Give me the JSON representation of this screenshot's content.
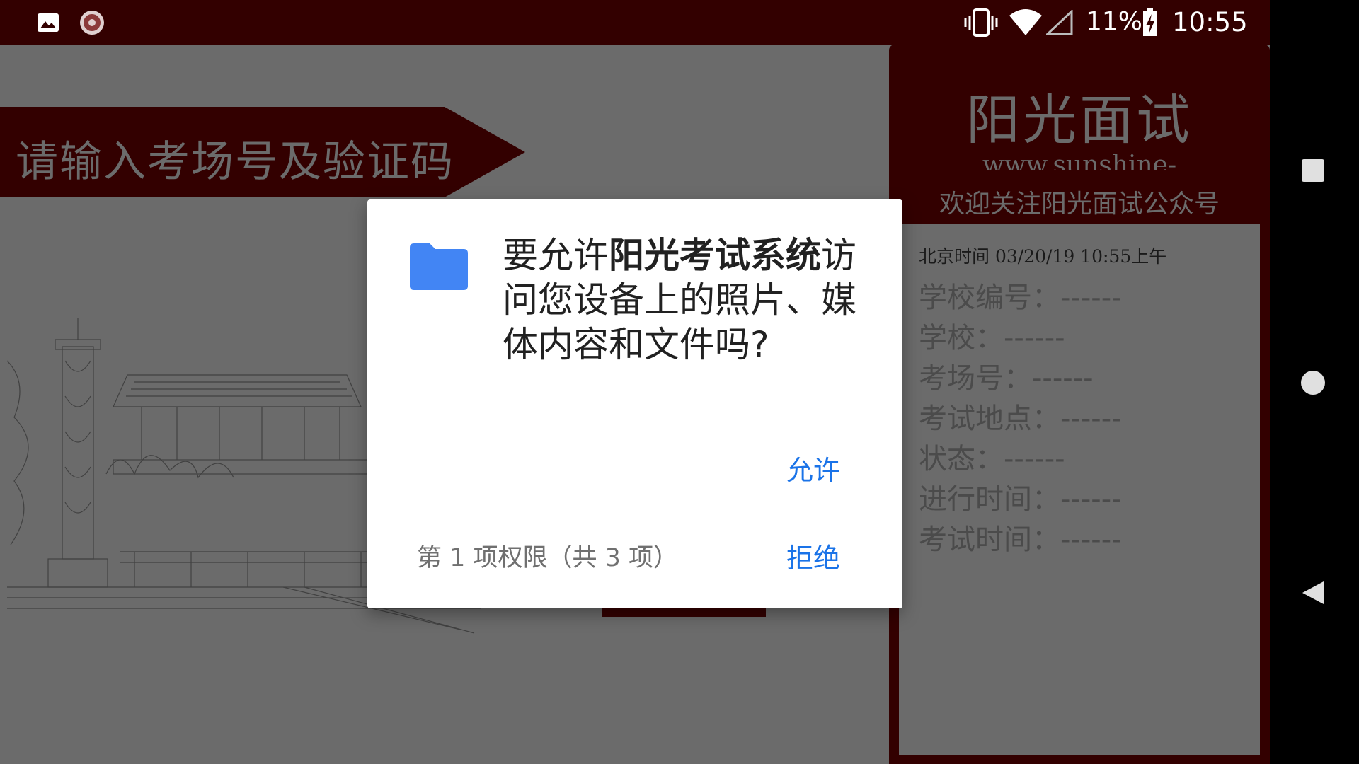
{
  "status_bar": {
    "battery_percent": "11%",
    "time": "10:55",
    "icons": [
      "image-icon",
      "record-disc-icon",
      "vibrate-icon",
      "wifi-icon",
      "signal-icon",
      "battery-charging-icon"
    ]
  },
  "navigation_bar": {
    "icons": [
      "recents-square-icon",
      "home-circle-icon",
      "back-triangle-icon"
    ]
  },
  "banner": {
    "text": "请输入考场号及验证码"
  },
  "info_panel": {
    "title": "阳光面试",
    "url": "www.sunshine-",
    "subtitle": "欢迎关注阳光面试公众号",
    "datetime": "北京时间 03/20/19 10:55上午",
    "fields": [
      "学校编号：------",
      "学校：------",
      "考场号：------",
      "考试地点：------",
      "状态：------",
      "进行时间：------",
      "考试时间：------"
    ]
  },
  "permission_dialog": {
    "icon": "folder-icon",
    "message_prefix": "要允许",
    "app_name": "阳光考试系统",
    "message_suffix": "访问您设备上的照片、媒体内容和文件吗?",
    "allow_label": "允许",
    "counter_text": "第 1 项权限（共 3 项）",
    "deny_label": "拒绝"
  },
  "colors": {
    "brand_dark_red": "#330000",
    "dim_background": "#6b6b6b",
    "dialog_accent": "#1a73e8",
    "folder_blue": "#4285f4"
  }
}
